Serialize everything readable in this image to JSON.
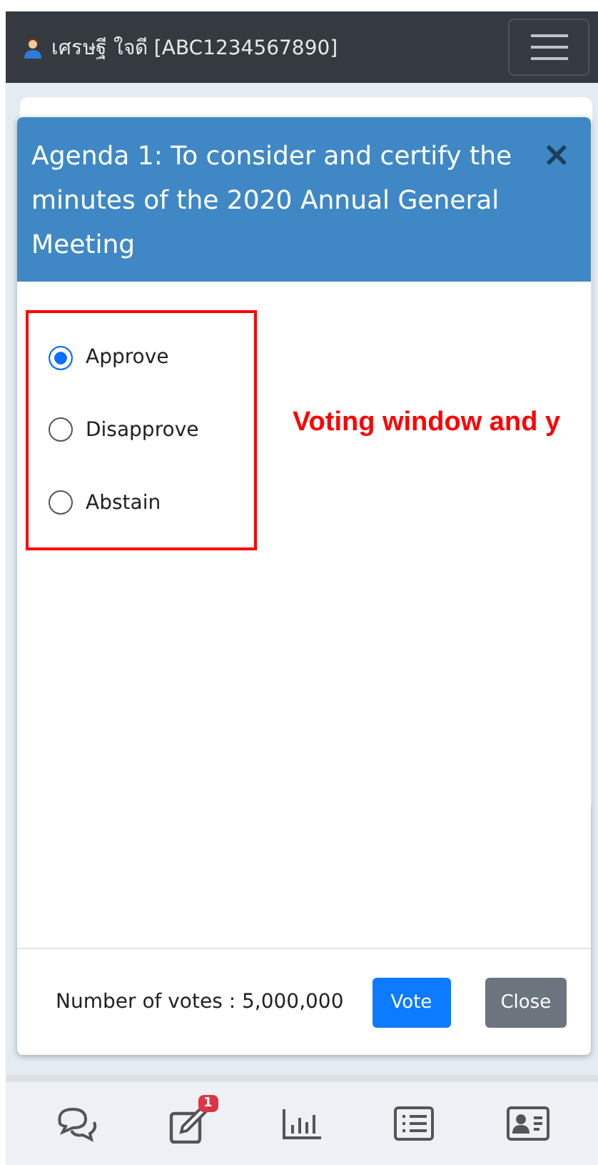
{
  "top_bar": {
    "user_name": "เศรษฐี ใจดี [ABC1234567890]"
  },
  "dialog": {
    "title": "Agenda 1: To consider and certify the minutes of the 2020 Annual General Meeting",
    "close_label": "×",
    "options": [
      {
        "label": "Approve",
        "selected": true
      },
      {
        "label": "Disapprove",
        "selected": false
      },
      {
        "label": "Abstain",
        "selected": false
      }
    ],
    "vote_count": "Number of votes : 5,000,000",
    "buttons": [
      {
        "label": "Vote",
        "kind": "primary"
      },
      {
        "label": "Close",
        "kind": "secondary"
      }
    ]
  },
  "annotation": {
    "text": "Voting window and y"
  },
  "bottom_nav": [
    {
      "kind": "chat"
    },
    {
      "kind": "edit",
      "badge": "1"
    },
    {
      "kind": "chart"
    },
    {
      "kind": "list"
    },
    {
      "kind": "contact"
    }
  ]
}
